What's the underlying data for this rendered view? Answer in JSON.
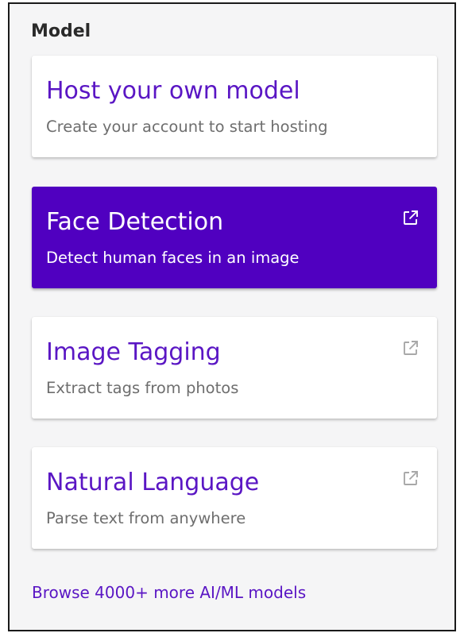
{
  "section": {
    "title": "Model"
  },
  "cards": [
    {
      "title": "Host your own model",
      "description": "Create your account to start hosting",
      "active": false,
      "icon": ""
    },
    {
      "title": "Face Detection",
      "description": "Detect human faces in an image",
      "active": true,
      "icon": "external-link-icon"
    },
    {
      "title": "Image Tagging",
      "description": "Extract tags from photos",
      "active": false,
      "icon": "external-link-icon"
    },
    {
      "title": "Natural Language",
      "description": "Parse text from anywhere",
      "active": false,
      "icon": "external-link-icon"
    }
  ],
  "browse_link": {
    "label": "Browse 4000+ more AI/ML models"
  },
  "colors": {
    "accent": "#5000c0",
    "link": "#5a16c4",
    "panel_background": "#f5f5f6",
    "card_background": "#ffffff",
    "muted_text": "#6e6e6e"
  }
}
